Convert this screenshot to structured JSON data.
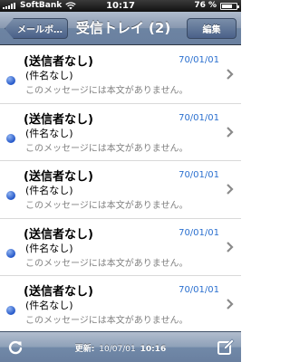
{
  "status_bar": {
    "carrier": "SoftBank",
    "time": "10:17",
    "battery": "76 %",
    "battery_level": 0.76
  },
  "nav": {
    "back_label": "メールボ…",
    "title": "受信トレイ (2)",
    "edit_label": "編集"
  },
  "messages": [
    {
      "sender": "(送信者なし)",
      "date": "70/01/01",
      "subject": "(件名なし)",
      "preview": "このメッセージには本文がありません。",
      "unread": true
    },
    {
      "sender": "(送信者なし)",
      "date": "70/01/01",
      "subject": "(件名なし)",
      "preview": "このメッセージには本文がありません。",
      "unread": true
    },
    {
      "sender": "(送信者なし)",
      "date": "70/01/01",
      "subject": "(件名なし)",
      "preview": "このメッセージには本文がありません。",
      "unread": true
    },
    {
      "sender": "(送信者なし)",
      "date": "70/01/01",
      "subject": "(件名なし)",
      "preview": "このメッセージには本文がありません。",
      "unread": true
    },
    {
      "sender": "(送信者なし)",
      "date": "70/01/01",
      "subject": "(件名なし)",
      "preview": "このメッセージには本文がありません。",
      "unread": true
    }
  ],
  "toolbar": {
    "updated_label": "更新:",
    "updated_date": "10/07/01",
    "updated_time": "10:16",
    "refresh_icon": "refresh-icon",
    "compose_icon": "compose-icon"
  },
  "colors": {
    "date_blue": "#2a6fcf",
    "unread_dot": "#2457c9"
  }
}
